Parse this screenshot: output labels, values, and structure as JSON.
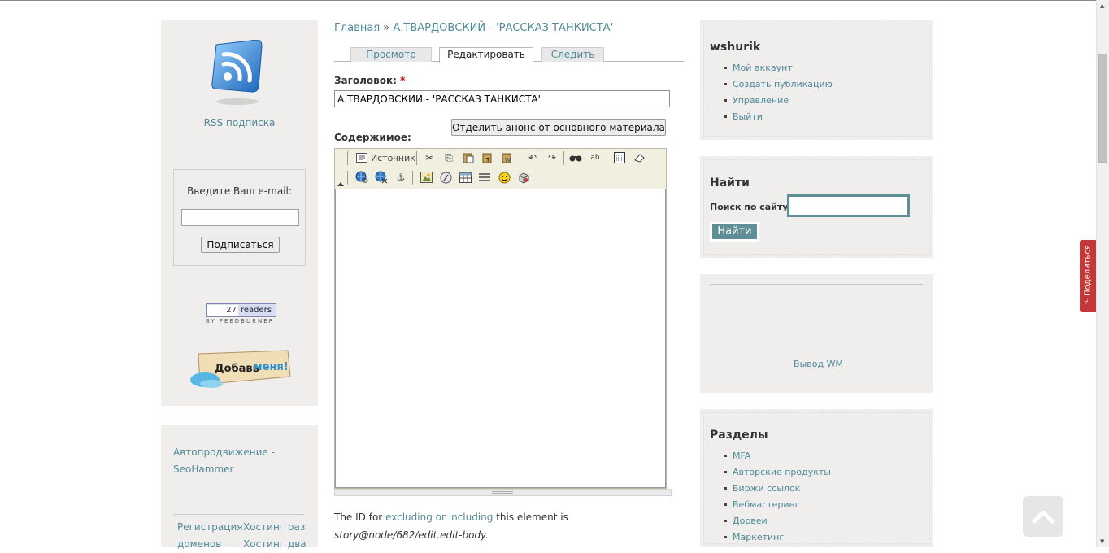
{
  "left": {
    "rss_label": "RSS подписка",
    "subscribe": {
      "label": "Введите Ваш e-mail:",
      "email_value": "",
      "button": "Подписаться"
    },
    "feedburner": {
      "count": "27",
      "label": "readers",
      "byline": "BY FEEDBURNER"
    },
    "addme": {
      "text_a": "Добавь",
      "text_b": "меня!"
    },
    "seo_link": "Автопродвижение - SeoHammer",
    "footer_links": [
      "Регистрация",
      "Хостинг раз",
      "доменов",
      "Хостинг два"
    ]
  },
  "breadcrumb": {
    "home": "Главная",
    "sep": "»",
    "current": "А.ТВАРДОВСКИЙ - 'РАССКАЗ ТАНКИСТА'"
  },
  "tabs": [
    "Просмотр",
    "Редактировать",
    "Следить"
  ],
  "form": {
    "title_label": "Заголовок:",
    "required_mark": "*",
    "title_value": "А.ТВАРДОВСКИЙ - 'РАССКАЗ ТАНКИСТА'",
    "split_button": "Отделить анонс от основного материала",
    "content_label": "Содержимое:"
  },
  "editor": {
    "source_label": "Источник",
    "toolbar_row1": [
      "source-icon",
      "cut-icon",
      "copy-icon",
      "paste-icon",
      "paste-text-icon",
      "paste-word-icon",
      "undo-icon",
      "redo-icon",
      "find-icon",
      "replace-icon",
      "select-all-icon",
      "remove-format-icon"
    ],
    "toolbar_row2": [
      "link-icon",
      "unlink-icon",
      "anchor-icon",
      "image-icon",
      "flash-icon",
      "table-icon",
      "horizontal-rule-icon",
      "smiley-icon",
      "special-char-icon"
    ],
    "content": ""
  },
  "id_note": {
    "prefix": "The ID for",
    "link": "excluding or including",
    "middle": "this element is",
    "id": "story@node/682/edit.edit-body",
    "suffix": "."
  },
  "right": {
    "user": {
      "name": "wshurik",
      "links": [
        "Мой аккаунт",
        "Создать публикацию",
        "Управление",
        "Выйти"
      ]
    },
    "search": {
      "title": "Найти",
      "label": "Поиск по сайту:",
      "value": "",
      "button": "Найти"
    },
    "wm_link": "Вывод WM",
    "sections": {
      "title": "Разделы",
      "links": [
        "MFA",
        "Авторские продукты",
        "Биржи ссылок",
        "Вебмастеринг",
        "Дорвеи",
        "Маркетинг"
      ]
    }
  },
  "share_label": "Поделиться",
  "colors": {
    "link": "#4f8a9a",
    "accent": "#5e8f98",
    "sidebar_bg": "#efeeec",
    "share_tab": "#c5383a"
  }
}
